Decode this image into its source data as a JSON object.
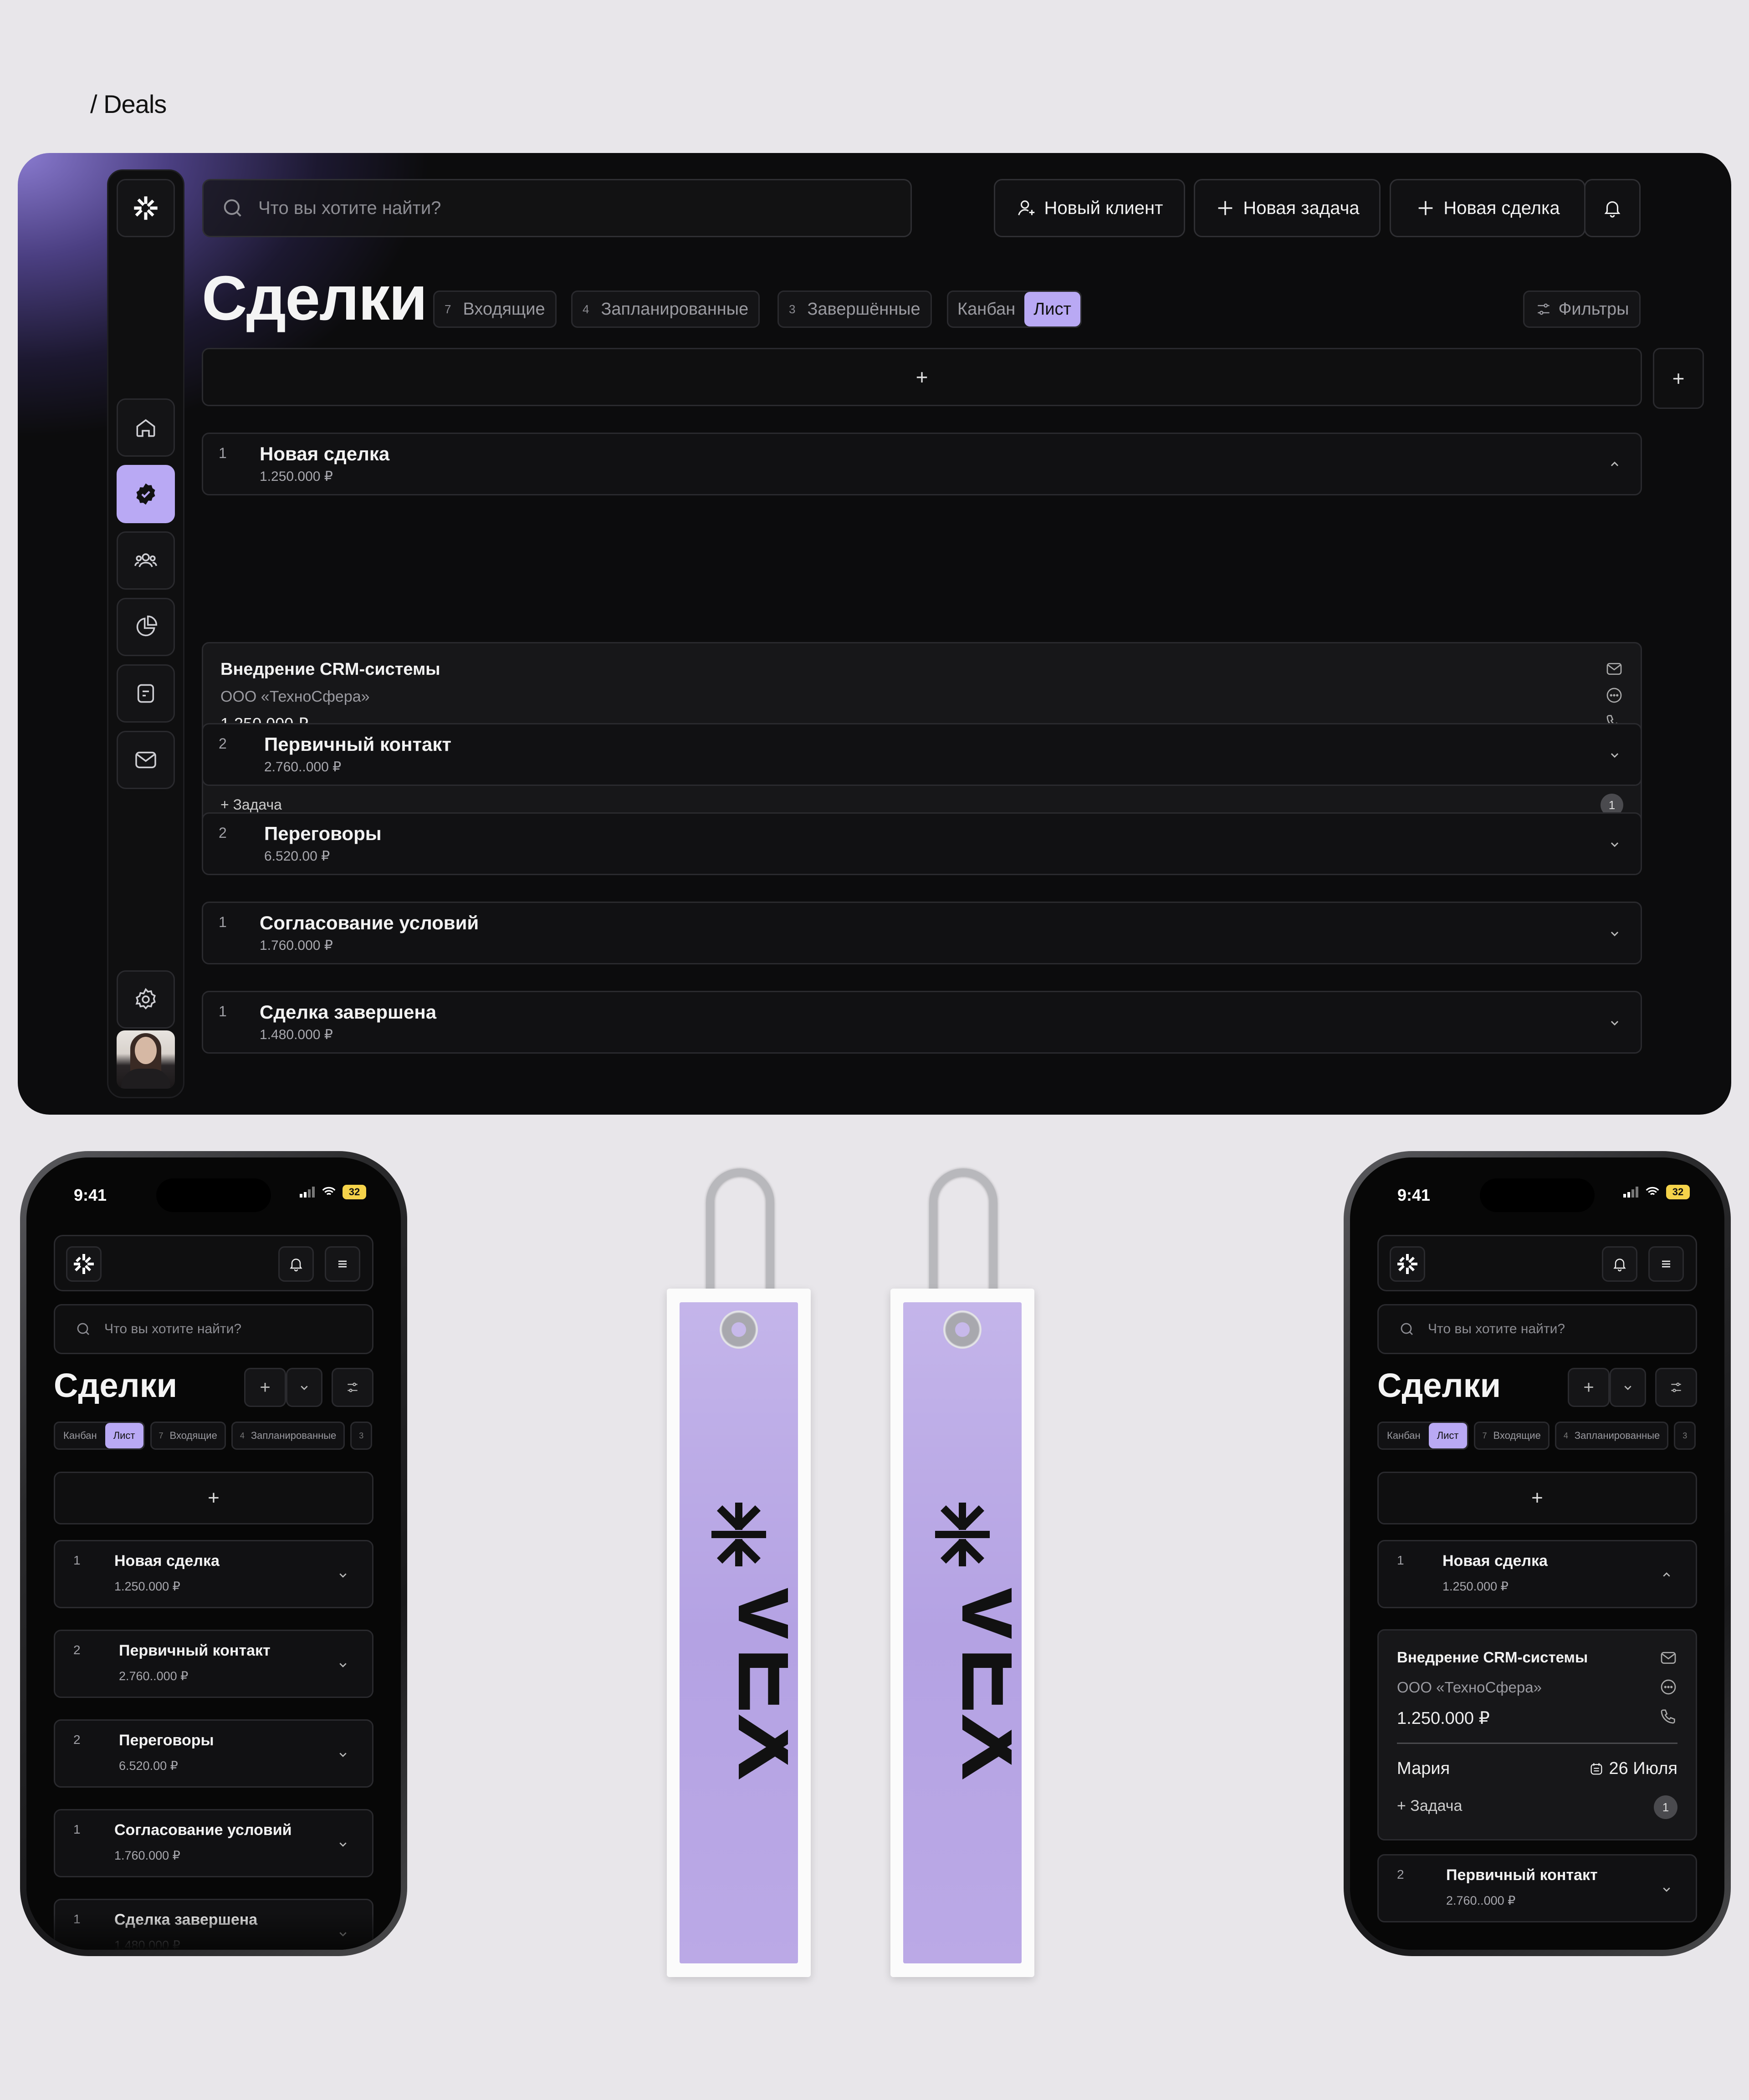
{
  "breadcrumb": "/ Deals",
  "desktop": {
    "search_placeholder": "Что вы хотите найти?",
    "buttons": {
      "new_client": "Новый клиент",
      "new_task": "Новая задача",
      "new_deal": "Новая сделка"
    },
    "title": "Сделки",
    "tabs": [
      {
        "count": "7",
        "label": "Входящие"
      },
      {
        "count": "4",
        "label": "Запланированные"
      },
      {
        "count": "3",
        "label": "Завершённые"
      }
    ],
    "view": {
      "kanban": "Канбан",
      "list": "Лист"
    },
    "filters": "Фильтры",
    "add": "+",
    "stages": [
      {
        "num": "1",
        "title": "Новая сделка",
        "amount": "1.250.000 ₽"
      },
      {
        "num": "2",
        "title": "Первичный контакт",
        "amount": "2.760..000 ₽"
      },
      {
        "num": "2",
        "title": "Переговоры",
        "amount": "6.520.00 ₽"
      },
      {
        "num": "1",
        "title": "Согласование условий",
        "amount": "1.760.000 ₽"
      },
      {
        "num": "1",
        "title": "Сделка завершена",
        "amount": "1.480.000 ₽"
      }
    ],
    "card": {
      "title": "Внедрение CRM-системы",
      "company": "ООО «ТехноСфера»",
      "amount": "1.250.000 ₽",
      "manager": "Мария",
      "date": "26 Июля",
      "task": "+ Задача",
      "badge": "1"
    }
  },
  "phone": {
    "time": "9:41",
    "battery": "32",
    "search_placeholder": "Что вы хотите найти?",
    "title": "Сделки",
    "kanban": "Канбан",
    "list": "Лист",
    "tabs": [
      {
        "count": "7",
        "label": "Входящие"
      },
      {
        "count": "4",
        "label": "Запланированные"
      },
      {
        "count": "3",
        "label": ""
      }
    ]
  },
  "keychain": {
    "brand": "VEX"
  },
  "colors": {
    "accent": "#b9a9f4",
    "background": "#e8e6ea",
    "panel": "#0c0c0d"
  }
}
